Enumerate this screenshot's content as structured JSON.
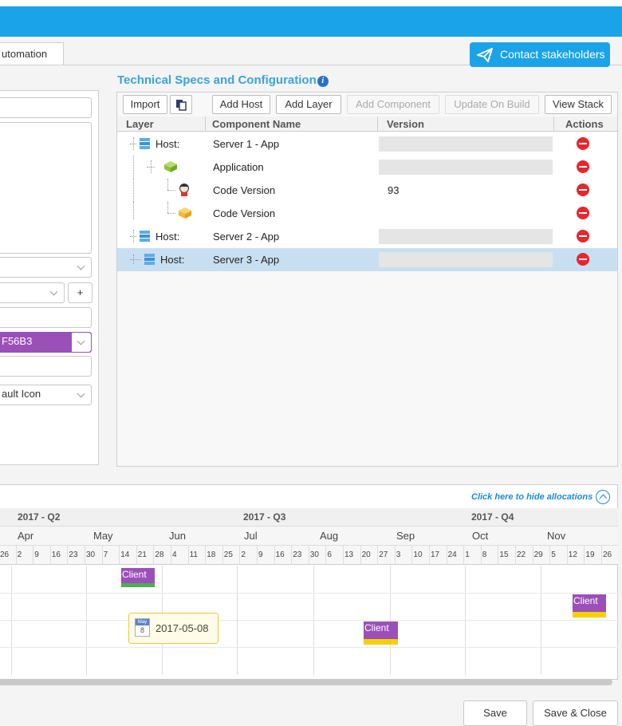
{
  "tab": {
    "label": "utomation"
  },
  "contact_button": {
    "label": "Contact stakeholders"
  },
  "left_panel": {
    "color_value": "F56B3",
    "icon_select": "ault Icon",
    "add_label": "+"
  },
  "specs": {
    "title": "Technical Specs and Configuration",
    "info_icon": "i",
    "toolbar": {
      "import": "Import",
      "add_host": "Add Host",
      "add_layer": "Add Layer",
      "add_component": "Add Component",
      "update_on_build": "Update On Build",
      "view_stack": "View Stack"
    },
    "columns": {
      "layer": "Layer",
      "component": "Component Name",
      "version": "Version",
      "actions": "Actions"
    },
    "rows": [
      {
        "layer": "Host:",
        "component": "Server 1 - App",
        "version": ""
      },
      {
        "layer": "",
        "component": "Application",
        "version": ""
      },
      {
        "layer": "",
        "component": "Code Version",
        "version": "93"
      },
      {
        "layer": "",
        "component": "Code Version",
        "version": ""
      },
      {
        "layer": "Host:",
        "component": "Server 2 - App",
        "version": ""
      },
      {
        "layer": "Host:",
        "component": "Server 3 - App",
        "version": ""
      }
    ]
  },
  "timeline": {
    "hide_link": "Click here to hide allocations",
    "quarters": [
      "2017 - Q2",
      "2017 - Q3",
      "2017 - Q4"
    ],
    "months": [
      "Apr",
      "May",
      "Jun",
      "Jul",
      "Aug",
      "Sep",
      "Oct",
      "Nov"
    ],
    "weeks": [
      "26",
      "2",
      "9",
      "16",
      "23",
      "30",
      "7",
      "14",
      "21",
      "28",
      "4",
      "11",
      "18",
      "25",
      "2",
      "9",
      "16",
      "23",
      "30",
      "6",
      "13",
      "20",
      "27",
      "3",
      "10",
      "17",
      "24",
      "1",
      "8",
      "15",
      "22",
      "29",
      "5",
      "12",
      "19",
      "26"
    ],
    "allocations": [
      {
        "label": "Client",
        "bar_color": "#4caf50"
      },
      {
        "label": "Client",
        "bar_color": "#f5d000"
      },
      {
        "label": "Client",
        "bar_color": "#f5d000"
      }
    ],
    "date_pill": {
      "month": "May",
      "day": "8",
      "date": "2017-05-08"
    },
    "allocation_color": "#9b4fb8"
  },
  "footer": {
    "save": "Save",
    "save_close": "Save & Close"
  },
  "colors": {
    "brand": "#1aa3e8",
    "title": "#3aa3db",
    "delete": "#e8262b",
    "selected_row": "#c8dff1"
  }
}
